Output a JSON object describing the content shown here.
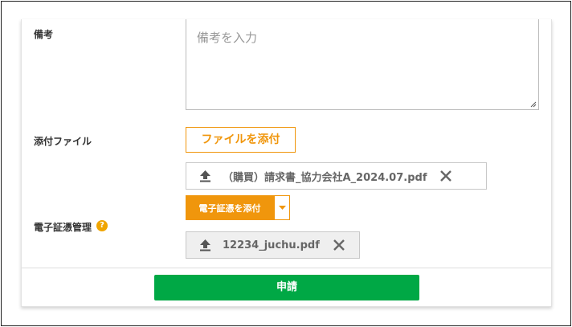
{
  "remarks": {
    "label": "備考",
    "placeholder": "備考を入力"
  },
  "attachments": {
    "label": "添付ファイル",
    "attach_button": "ファイルを添付",
    "files": [
      {
        "name": "（購買）請求書_協力会社A_2024.07.pdf"
      }
    ]
  },
  "e_evidence": {
    "label": "電子証憑管理",
    "help_mark": "?",
    "attach_button": "電子証憑を添付",
    "files": [
      {
        "name": "12234_juchu.pdf"
      }
    ]
  },
  "submit": {
    "label": "申請"
  },
  "colors": {
    "accent_orange": "#f0960c",
    "submit_green": "#00a845",
    "help_yellow": "#f0a500"
  }
}
